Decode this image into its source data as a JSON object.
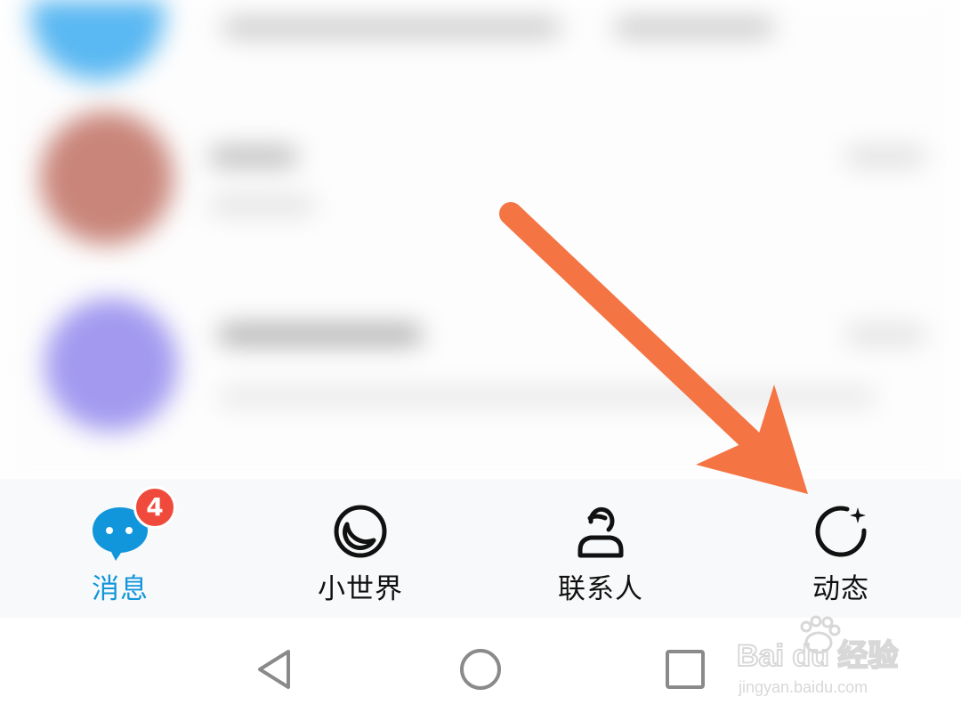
{
  "tabs": [
    {
      "id": "messages",
      "label": "消息",
      "icon": "chat-bubble-icon",
      "active": true,
      "badge": "4"
    },
    {
      "id": "small-world",
      "label": "小世界",
      "icon": "small-world-ring-icon",
      "active": false
    },
    {
      "id": "contacts",
      "label": "联系人",
      "icon": "person-icon",
      "active": false
    },
    {
      "id": "moments",
      "label": "动态",
      "icon": "star-refresh-icon",
      "active": false
    }
  ],
  "navigation": [
    "back-icon",
    "home-icon",
    "recents-icon"
  ],
  "watermark": {
    "brand": "Bai du 经验",
    "url": "jingyan.baidu.com"
  },
  "colors": {
    "accent": "#1296db",
    "badge": "#ef4a3b",
    "arrow": "#f47444",
    "tabbar_bg": "#f8f9fa"
  }
}
